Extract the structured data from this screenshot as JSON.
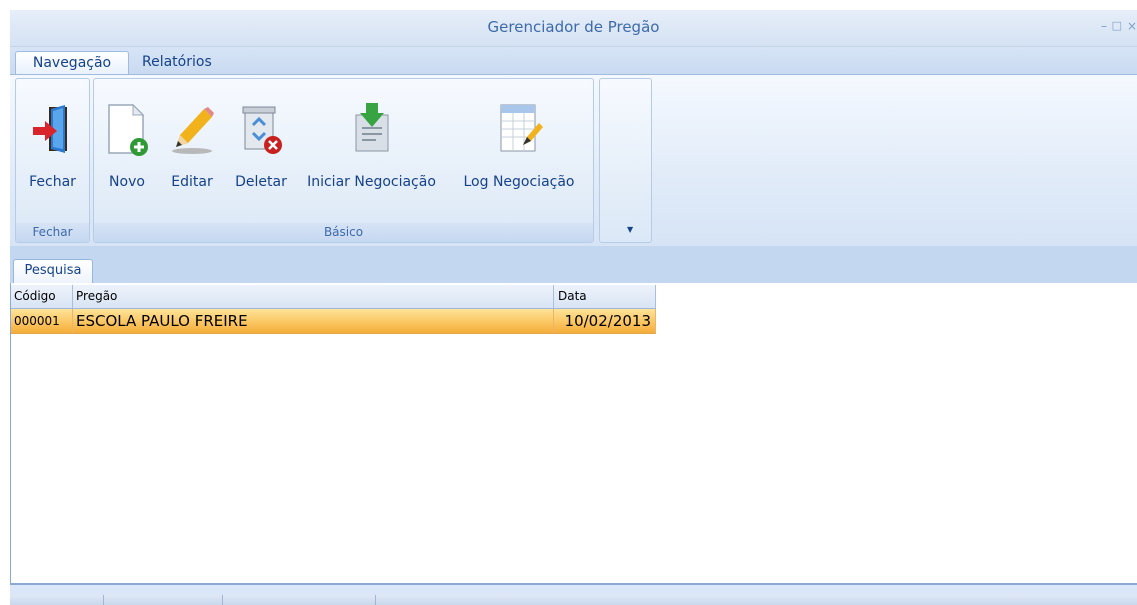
{
  "window": {
    "title": "Gerenciador de Pregão",
    "minimize": "–",
    "maximize": "□",
    "close": "×"
  },
  "ribbon": {
    "tabs": [
      {
        "label": "Navegação",
        "active": true
      },
      {
        "label": "Relatórios",
        "active": false
      }
    ],
    "groups": [
      {
        "label": "Fechar",
        "buttons": [
          {
            "label": "Fechar",
            "icon": "exit-door-icon"
          }
        ]
      },
      {
        "label": "Básico",
        "buttons": [
          {
            "label": "Novo",
            "icon": "new-document-icon"
          },
          {
            "label": "Editar",
            "icon": "pencil-icon"
          },
          {
            "label": "Deletar",
            "icon": "recycle-bin-delete-icon"
          },
          {
            "label": "Iniciar Negociação",
            "icon": "start-negotiation-icon"
          },
          {
            "label": "Log Negociação",
            "icon": "log-sheet-icon"
          }
        ]
      }
    ],
    "overflow_arrow": "▼"
  },
  "document_tab": {
    "label": "Pesquisa"
  },
  "grid": {
    "columns": [
      "Código",
      "Pregão",
      "Data"
    ],
    "rows": [
      {
        "codigo": "000001",
        "pregao": "ESCOLA PAULO FREIRE",
        "data": "10/02/2013",
        "selected": true
      }
    ]
  },
  "colors": {
    "accent": "#15428b",
    "selection": "#fbc967",
    "ribbon_bg": "#dbe7f8"
  }
}
